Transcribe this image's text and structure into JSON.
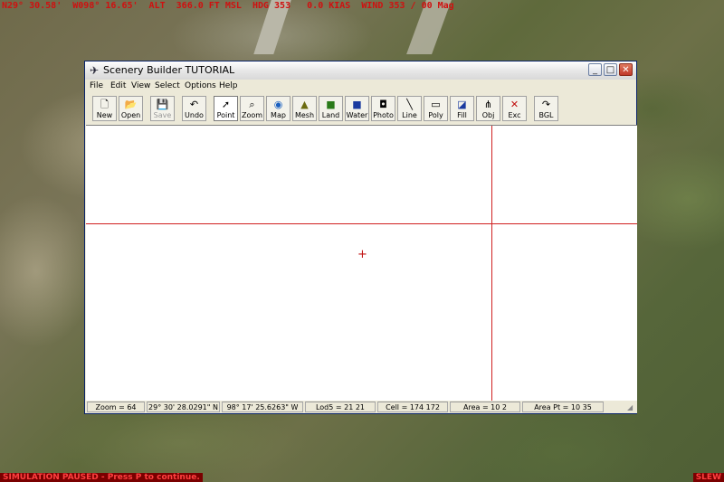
{
  "sim": {
    "hud": "N29° 30.58'  W098° 16.65'  ALT  366.0 FT MSL  HDG 353   0.0 KIAS  WIND 353 / 00 Mag",
    "paused": "SIMULATION PAUSED - Press P to continue.",
    "slew": "SLEW"
  },
  "window": {
    "title": "Scenery Builder  TUTORIAL",
    "minimize": "_",
    "maximize": "□",
    "close": "✕"
  },
  "menu": [
    "File",
    "Edit",
    "View",
    "Select",
    "Options",
    "Help"
  ],
  "toolbar": [
    {
      "label": "New",
      "icon": "new-icon",
      "glyph": "🗋"
    },
    {
      "label": "Open",
      "icon": "open-icon",
      "glyph": "📂"
    },
    {
      "label": "Save",
      "icon": "save-icon",
      "glyph": "💾"
    },
    {
      "label": "Undo",
      "icon": "undo-icon",
      "glyph": "↶"
    },
    {
      "label": "Point",
      "icon": "pointer-icon",
      "glyph": "➚"
    },
    {
      "label": "Zoom",
      "icon": "magnifier-icon",
      "glyph": "⌕"
    },
    {
      "label": "Map",
      "icon": "globe-icon",
      "glyph": "◉"
    },
    {
      "label": "Mesh",
      "icon": "mountain-icon",
      "glyph": "▲"
    },
    {
      "label": "Land",
      "icon": "land-icon",
      "glyph": "■"
    },
    {
      "label": "Water",
      "icon": "water-icon",
      "glyph": "■"
    },
    {
      "label": "Photo",
      "icon": "camera-icon",
      "glyph": "◘"
    },
    {
      "label": "Line",
      "icon": "line-icon",
      "glyph": "╲"
    },
    {
      "label": "Poly",
      "icon": "polygon-icon",
      "glyph": "▭"
    },
    {
      "label": "Fill",
      "icon": "fill-icon",
      "glyph": "◪"
    },
    {
      "label": "Obj",
      "icon": "objects-icon",
      "glyph": "⋔"
    },
    {
      "label": "Exc",
      "icon": "exclude-icon",
      "glyph": "✕"
    },
    {
      "label": "BGL",
      "icon": "compile-icon",
      "glyph": "↷"
    }
  ],
  "colors": {
    "accent_red": "#d02020",
    "land_green": "#2a7a1a",
    "water_blue": "#1a3aa0",
    "exclude_red": "#c01010"
  },
  "status": {
    "zoom": "Zoom = 64",
    "lat": "29° 30' 28.0291\" N",
    "lon": "98° 17' 25.6263\" W",
    "lod": "Lod5 = 21 21",
    "cell": "Cell = 174 172",
    "area": "Area = 10 2",
    "area_pt": "Area Pt = 10 35"
  },
  "canvas": {
    "crosshair": "+"
  }
}
